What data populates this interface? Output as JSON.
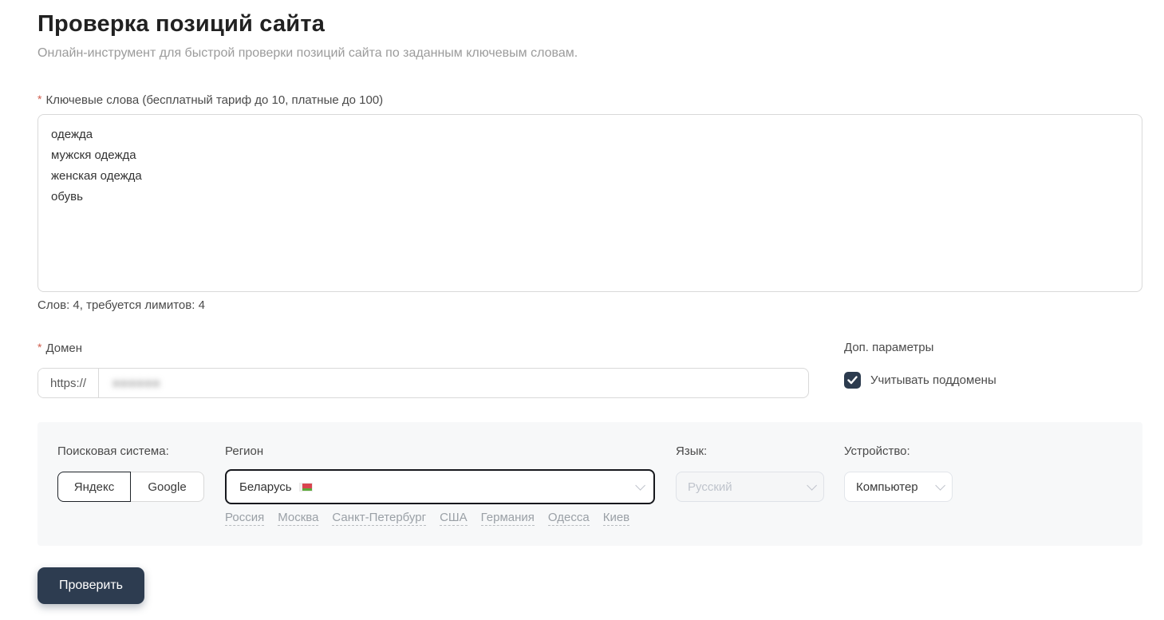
{
  "page": {
    "title": "Проверка позиций сайта",
    "subtitle": "Онлайн-инструмент для быстрой проверки позиций сайта по заданным ключевым словам."
  },
  "keywords": {
    "required_mark": "*",
    "label": "Ключевые слова (бесплатный тариф до 10, платные до 100)",
    "value": "одежда\nмужскя одежда\nженская одежда\nобувь",
    "counter": "Слов: 4, требуется лимитов: 4"
  },
  "domain": {
    "required_mark": "*",
    "label": "Домен",
    "protocol_prefix": "https://",
    "masked_value": "●●●●●●"
  },
  "extra_params": {
    "title": "Доп. параметры",
    "subdomains_label": "Учитывать поддомены",
    "subdomains_checked": true
  },
  "search_settings": {
    "engine_label": "Поисковая система:",
    "engines": [
      {
        "label": "Яндекс",
        "selected": true
      },
      {
        "label": "Google",
        "selected": false
      }
    ],
    "region_label": "Регион",
    "region_value": "Беларусь",
    "region_flag": "belarus-flag",
    "region_shortcuts": [
      "Россия",
      "Москва",
      "Санкт-Петербург",
      "США",
      "Германия",
      "Одесса",
      "Киев"
    ],
    "language_label": "Язык:",
    "language_value": "Русский",
    "language_disabled": true,
    "device_label": "Устройство:",
    "device_value": "Компьютер"
  },
  "actions": {
    "submit_label": "Проверить"
  },
  "colors": {
    "accent_dark": "#2d3c50",
    "required_red": "#cf5c4c",
    "panel_bg": "#f7f8f9",
    "region_border": "#16181d",
    "link_gray": "#9aa0a6"
  }
}
